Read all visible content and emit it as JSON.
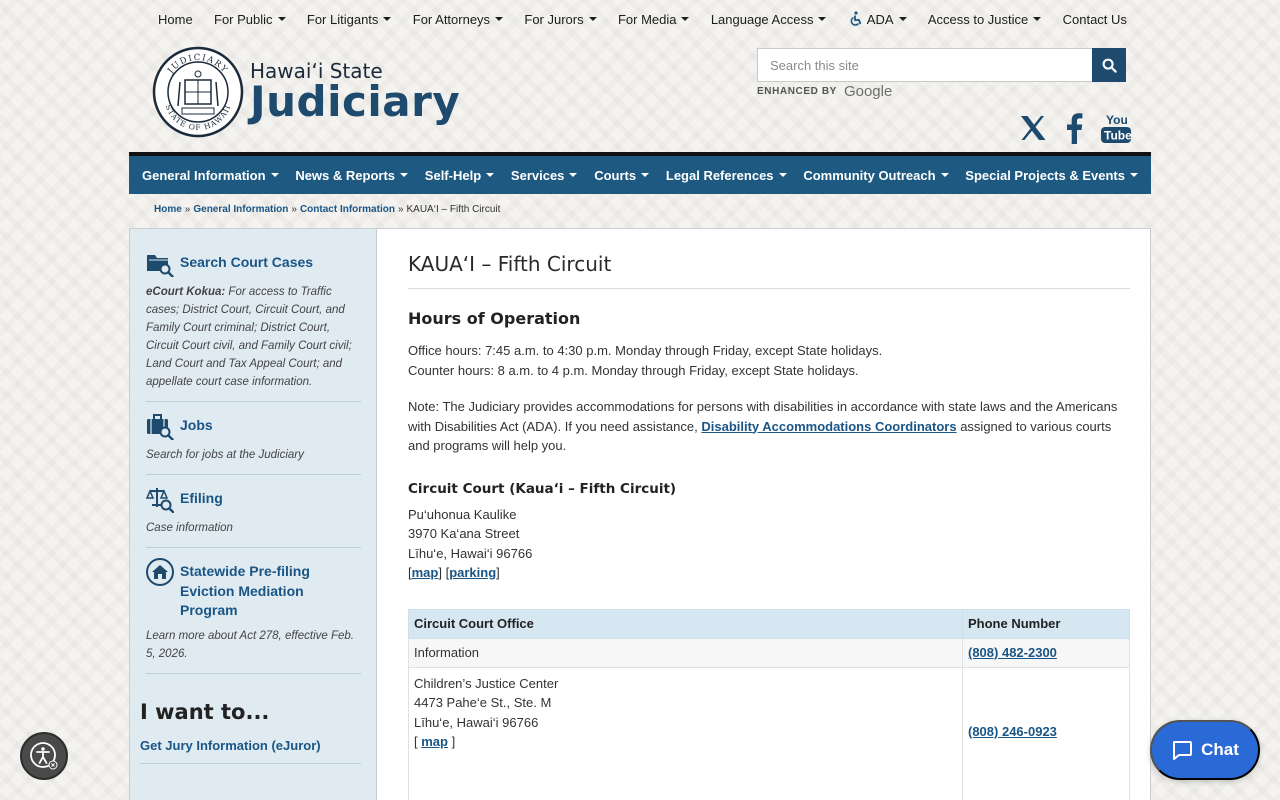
{
  "topnav": [
    {
      "label": "Home",
      "caret": false
    },
    {
      "label": "For Public",
      "caret": true
    },
    {
      "label": "For Litigants",
      "caret": true
    },
    {
      "label": "For Attorneys",
      "caret": true
    },
    {
      "label": "For Jurors",
      "caret": true
    },
    {
      "label": "For Media",
      "caret": true
    },
    {
      "label": "Language Access",
      "caret": true
    },
    {
      "label": "ADA",
      "caret": true,
      "icon": "wheelchair-icon"
    },
    {
      "label": "Access to Justice",
      "caret": true
    },
    {
      "label": "Contact Us",
      "caret": false
    }
  ],
  "logo": {
    "state": "Hawai‘i State",
    "judiciary": "Judiciary",
    "seal_top": "JUDICIARY",
    "seal_bottom": "STATE OF HAWAII"
  },
  "search": {
    "placeholder": "Search this site",
    "enhanced_by": "ENHANCED BY",
    "google": "Google"
  },
  "social": [
    "x-icon",
    "facebook-icon",
    "youtube-icon"
  ],
  "mainnav": [
    "General Information",
    "News & Reports",
    "Self-Help",
    "Services",
    "Courts",
    "Legal References",
    "Community Outreach",
    "Special Projects & Events"
  ],
  "breadcrumb": {
    "home": "Home",
    "general": "General Information",
    "contact": "Contact Information",
    "current": "KAUA‘I – Fifth Circuit",
    "sep": "»"
  },
  "sidebar": {
    "search_cases": {
      "title": "Search Court Cases",
      "bold": "eCourt Kokua:",
      "desc": " For access to Traffic cases; District Court, Circuit Court, and Family Court criminal; District Court, Circuit Court civil, and Family Court civil; Land Court and Tax Appeal Court; and appellate court case information."
    },
    "jobs": {
      "title": "Jobs",
      "desc": "Search for jobs at the Judiciary"
    },
    "efiling": {
      "title": "Efiling",
      "desc": "Case information"
    },
    "eviction": {
      "title": "Statewide Pre-filing Eviction Mediation Program",
      "desc": "Learn more about Act 278, effective Feb. 5, 2026."
    },
    "iwant": "I want to...",
    "iwant_link": "Get Jury Information (eJuror)"
  },
  "main": {
    "title": "KAUA‘I – Fifth Circuit",
    "hours_heading": "Hours of Operation",
    "office_hours": "Office hours: 7:45 a.m. to 4:30 p.m. Monday through Friday, except State holidays.",
    "counter_hours": "Counter hours: 8 a.m. to 4 p.m. Monday through Friday, except State holidays.",
    "note_before": "Note: The Judiciary provides accommodations for persons with disabilities in accordance with state laws and the Americans with Disabilities Act (ADA). If you need assistance, ",
    "note_link": "Disability Accommodations Coordinators",
    "note_after": " assigned to various courts and programs will help you.",
    "court_heading": "Circuit Court (Kaua‘i – Fifth Circuit)",
    "address": [
      "Pu‘uhonua Kaulike",
      "3970 Ka‘ana Street",
      "Līhu‘e, Hawai‘i 96766"
    ],
    "map": "map",
    "parking": "parking"
  },
  "table": {
    "col1": "Circuit Court Office",
    "col2": "Phone Number",
    "row1": {
      "office": "Information",
      "phone": "(808) 482-2300"
    },
    "row2": {
      "lines": [
        "Children’s Justice Center",
        "4473 Pahe‘e St., Ste. M",
        "Līhu‘e, Hawai‘i 96766"
      ],
      "map": "map",
      "phone": "(808) 246-0923"
    }
  },
  "chat": {
    "label": "Chat"
  },
  "colors": {
    "nav": "#1d5980",
    "accent": "#1a5585",
    "sidebar": "#dfeaf1",
    "chat": "#2a6ad6"
  }
}
